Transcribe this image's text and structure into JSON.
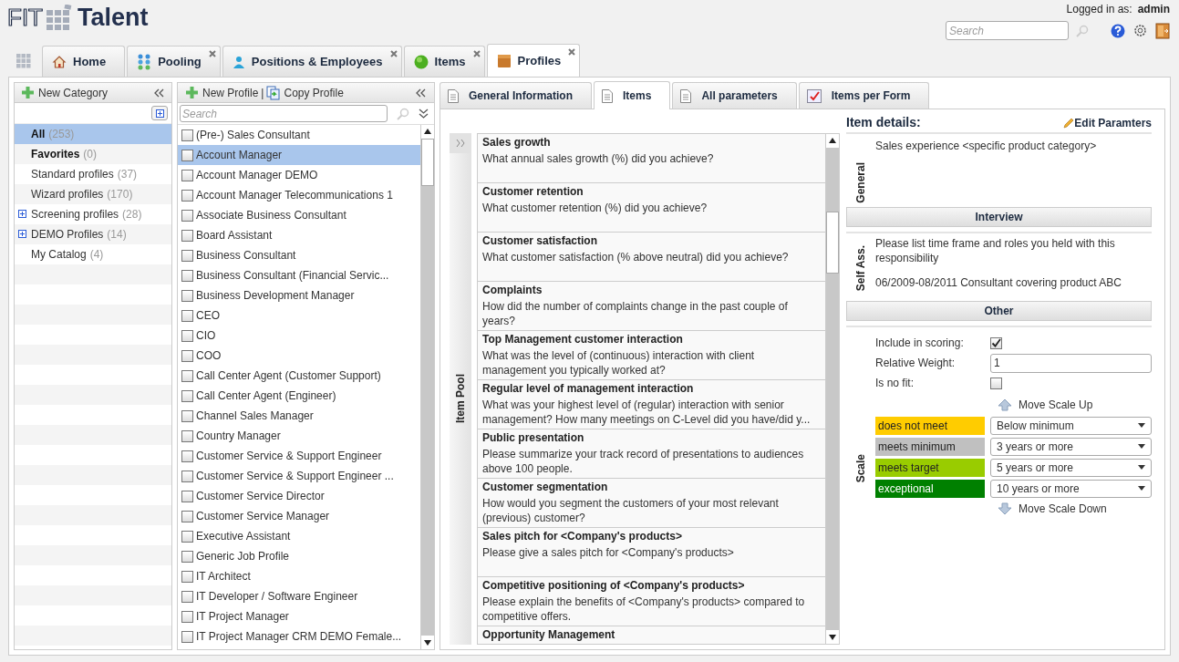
{
  "logo": {
    "left": "FIT",
    "right": "Talent"
  },
  "user": {
    "label": "Logged in as:",
    "name": "admin"
  },
  "search": {
    "placeholder": "Search"
  },
  "tabs": [
    {
      "label": "Home",
      "selected": false,
      "closable": false,
      "kind": "home"
    },
    {
      "label": "Pooling",
      "selected": false,
      "closable": true,
      "kind": "pooling"
    },
    {
      "label": "Positions & Employees",
      "selected": false,
      "closable": true,
      "kind": "person"
    },
    {
      "label": "Items",
      "selected": false,
      "closable": true,
      "kind": "ball"
    },
    {
      "label": "Profiles",
      "selected": true,
      "closable": true,
      "kind": "box"
    }
  ],
  "categories_panel": {
    "new_button": "New Category",
    "categories": [
      {
        "name": "All",
        "count": "(253)",
        "bold": true,
        "expandable": false,
        "selected": true
      },
      {
        "name": "Favorites",
        "count": "(0)",
        "bold": true,
        "expandable": false,
        "selected": false
      },
      {
        "name": "Standard profiles",
        "count": "(37)",
        "bold": false,
        "expandable": false,
        "selected": false
      },
      {
        "name": "Wizard profiles",
        "count": "(170)",
        "bold": false,
        "expandable": false,
        "selected": false
      },
      {
        "name": "Screening profiles",
        "count": "(28)",
        "bold": false,
        "expandable": true,
        "selected": false
      },
      {
        "name": "DEMO Profiles",
        "count": "(14)",
        "bold": false,
        "expandable": true,
        "selected": false
      },
      {
        "name": "My Catalog",
        "count": "(4)",
        "bold": false,
        "expandable": false,
        "selected": false
      }
    ]
  },
  "profiles_panel": {
    "new_button": "New Profile",
    "separator": "|",
    "copy_button": "Copy Profile",
    "search_placeholder": "Search",
    "profiles": [
      {
        "name": "(Pre-) Sales Consultant",
        "selected": false,
        "checked": false
      },
      {
        "name": "Account Manager",
        "selected": true,
        "checked": false
      },
      {
        "name": "Account Manager DEMO",
        "selected": false,
        "checked": false
      },
      {
        "name": "Account Manager Telecommunications 1",
        "selected": false,
        "checked": false
      },
      {
        "name": "Associate Business Consultant",
        "selected": false,
        "checked": false
      },
      {
        "name": "Board Assistant",
        "selected": false,
        "checked": false
      },
      {
        "name": "Business Consultant",
        "selected": false,
        "checked": false
      },
      {
        "name": "Business Consultant (Financial Servic...",
        "selected": false,
        "checked": false
      },
      {
        "name": "Business Development Manager",
        "selected": false,
        "checked": false
      },
      {
        "name": "CEO",
        "selected": false,
        "checked": false
      },
      {
        "name": "CIO",
        "selected": false,
        "checked": false
      },
      {
        "name": "COO",
        "selected": false,
        "checked": false
      },
      {
        "name": "Call Center Agent (Customer Support)",
        "selected": false,
        "checked": false
      },
      {
        "name": "Call Center Agent (Engineer)",
        "selected": false,
        "checked": false
      },
      {
        "name": "Channel Sales Manager",
        "selected": false,
        "checked": false
      },
      {
        "name": "Country Manager",
        "selected": false,
        "checked": false
      },
      {
        "name": "Customer Service & Support Engineer",
        "selected": false,
        "checked": false
      },
      {
        "name": "Customer Service & Support Engineer ...",
        "selected": false,
        "checked": false
      },
      {
        "name": "Customer Service Director",
        "selected": false,
        "checked": false
      },
      {
        "name": "Customer Service Manager",
        "selected": false,
        "checked": false
      },
      {
        "name": "Executive Assistant",
        "selected": false,
        "checked": false
      },
      {
        "name": "Generic Job Profile",
        "selected": false,
        "checked": false
      },
      {
        "name": "IT Architect",
        "selected": false,
        "checked": false
      },
      {
        "name": "IT Developer / Software Engineer",
        "selected": false,
        "checked": false
      },
      {
        "name": "IT Project Manager",
        "selected": false,
        "checked": false
      },
      {
        "name": "IT Project Manager CRM DEMO Female...",
        "selected": false,
        "checked": false
      }
    ]
  },
  "detail_tabs": [
    {
      "label": "General Information",
      "selected": false,
      "kind": "page"
    },
    {
      "label": "Items",
      "selected": true,
      "kind": "page"
    },
    {
      "label": "All parameters",
      "selected": false,
      "kind": "page"
    },
    {
      "label": "Items per Form",
      "selected": false,
      "kind": "form"
    }
  ],
  "item_pool": {
    "label": "Item Pool",
    "items": [
      {
        "title": "Sales growth",
        "question": "What annual sales growth (%) did you achieve?"
      },
      {
        "title": "Customer retention",
        "question": "What customer retention (%) did you achieve?"
      },
      {
        "title": "Customer satisfaction",
        "question": "What customer satisfaction (% above neutral) did you achieve?"
      },
      {
        "title": "Complaints",
        "question": "How did the number of complaints change in the past couple of years?"
      },
      {
        "title": "Top Management customer interaction",
        "question": "What was the level of (continuous) interaction with client management you typically worked at?"
      },
      {
        "title": "Regular level of management interaction",
        "question": "What was your highest level of (regular) interaction with senior management? How many meetings on C-Level did you have/did y..."
      },
      {
        "title": "Public presentation",
        "question": "Please summarize your track record of presentations to audiences above 100 people."
      },
      {
        "title": "Customer segmentation",
        "question": "How would you segment the customers of your most relevant (previous) customer?"
      },
      {
        "title": "Sales pitch for <Company's products>",
        "question": "Please give a sales pitch for <Company's products>"
      },
      {
        "title": "Competitive positioning of <Company's products>",
        "question": "Please explain the benefits of <Company's products> compared to competitive offers."
      },
      {
        "title": "Opportunity Management"
      }
    ]
  },
  "item_details": {
    "title": "Item details:",
    "edit_button": "Edit Paramters",
    "general": {
      "label": "General",
      "text": "Sales experience <specific product category>"
    },
    "interview_header": "Interview",
    "self_assessment": {
      "label": "Self Ass.",
      "question": "Please list time frame and roles you held with this responsibility",
      "answer": "06/2009-08/2011 Consultant covering product ABC"
    },
    "other_header": "Other",
    "include_in_scoring": {
      "label": "Include in scoring:",
      "checked": true
    },
    "relative_weight": {
      "label": "Relative Weight:",
      "value": "1"
    },
    "is_no_fit": {
      "label": "Is no fit:",
      "checked": false
    },
    "scale": {
      "label": "Scale",
      "move_up": "Move Scale Up",
      "move_down": "Move Scale Down",
      "levels": [
        {
          "label": "does not meet",
          "color": "#ffcc00",
          "value": "Below minimum"
        },
        {
          "label": "meets minimum",
          "color": "#c0c0c0",
          "value": "3 years or more"
        },
        {
          "label": "meets target",
          "color": "#99cc00",
          "value": "5 years or more"
        },
        {
          "label": "exceptional",
          "color": "#008000",
          "value": "10 years or more"
        }
      ]
    }
  }
}
